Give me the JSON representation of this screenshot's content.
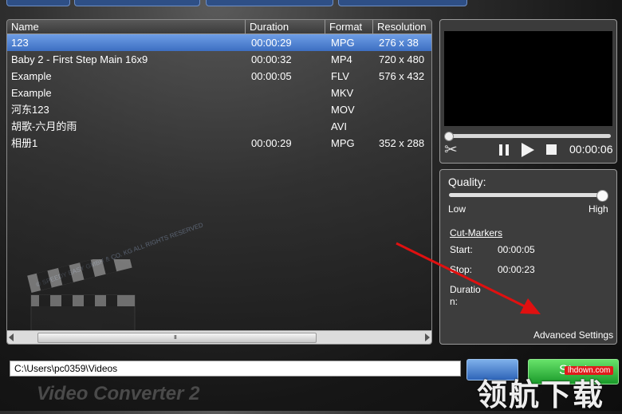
{
  "file_list": {
    "columns": [
      "Name",
      "Duration",
      "Format",
      "Resolution"
    ],
    "rows": [
      {
        "name": "123",
        "duration": "00:00:29",
        "format": "MPG",
        "resolution": "276 x 38",
        "selected": true
      },
      {
        "name": "Baby 2 - First Step Main 16x9",
        "duration": "00:00:32",
        "format": "MP4",
        "resolution": "720 x 480"
      },
      {
        "name": "Example",
        "duration": "00:00:05",
        "format": "FLV",
        "resolution": "576 x 432"
      },
      {
        "name": "Example",
        "duration": "",
        "format": "MKV",
        "resolution": ""
      },
      {
        "name": "河东123",
        "duration": "",
        "format": "MOV",
        "resolution": ""
      },
      {
        "name": "胡歌-六月的雨",
        "duration": "",
        "format": "AVI",
        "resolution": ""
      },
      {
        "name": "相册1",
        "duration": "00:00:29",
        "format": "MPG",
        "resolution": "352 x 288"
      }
    ],
    "watermark_text": "© SPEEDY EASY GMBH & CO. KG ALL RIGHTS RESERVED",
    "scroll_grip": "III"
  },
  "player": {
    "time": "00:00:06",
    "icons": [
      "scissors-icon",
      "pause-icon",
      "play-icon",
      "stop-icon"
    ]
  },
  "settings": {
    "quality_label": "Quality:",
    "quality_level": 1.0,
    "low_label": "Low",
    "high_label": "High",
    "cut_markers_label": "Cut-Markers",
    "start_label": "Start:",
    "start_value": "00:00:05",
    "stop_label": "Stop:",
    "stop_value": "00:00:23",
    "duration_label": "Duration:",
    "advanced_label": "Advanced Settings"
  },
  "bottom": {
    "path_value": "C:\\Users\\pc0359\\Videos",
    "start_button": "Start",
    "brand": "Video Converter 2"
  },
  "overlay": {
    "site_badge": "lhdown.com",
    "site_mark": "领航下载"
  },
  "colors": {
    "selection": "#4a7fd0",
    "start_button": "#2eb43a",
    "arrow": "#e01010"
  }
}
